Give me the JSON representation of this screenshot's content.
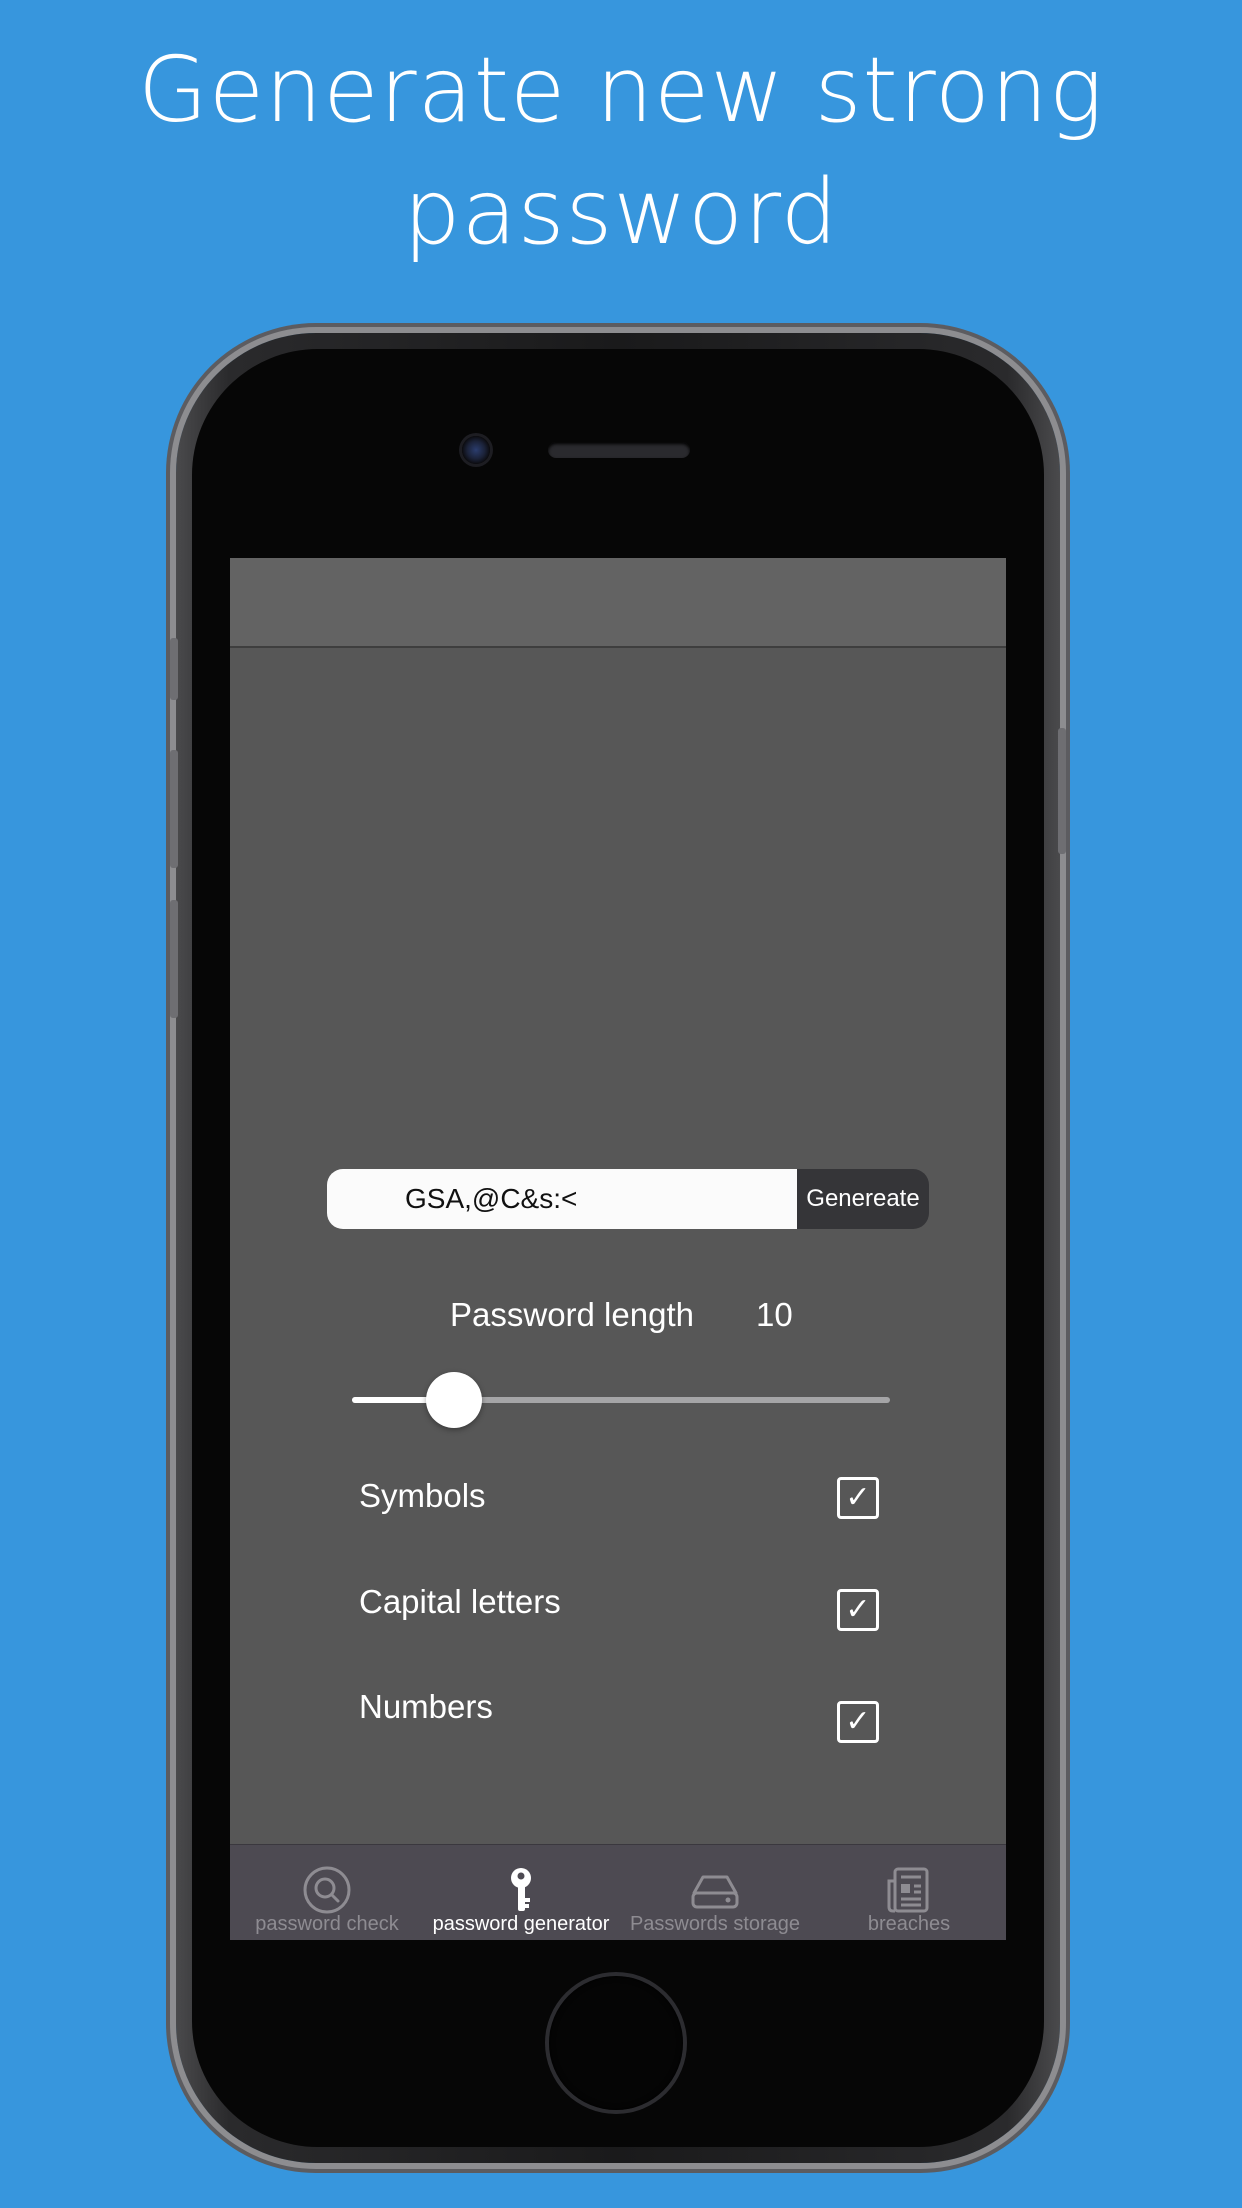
{
  "headline": {
    "line1": "Generate new strong",
    "line2": "password"
  },
  "generator": {
    "password_value": "GSA,@C&s:<",
    "generate_label": "Genereate",
    "length_label": "Password length",
    "length_value": "10",
    "slider_fraction": 0.19
  },
  "options": [
    {
      "label": "Symbols",
      "checked": true
    },
    {
      "label": "Capital letters",
      "checked": true
    },
    {
      "label": "Numbers",
      "checked": true
    }
  ],
  "tabbar": {
    "items": [
      {
        "label": "password check",
        "icon": "magnifier-icon",
        "active": false
      },
      {
        "label": "password generator",
        "icon": "key-icon",
        "active": true
      },
      {
        "label": "Passwords storage",
        "icon": "hard-drive-icon",
        "active": false
      },
      {
        "label": "breaches",
        "icon": "newspaper-icon",
        "active": false
      }
    ]
  },
  "colors": {
    "background": "#3796dd",
    "screen": "#575757",
    "navbar": "#636363",
    "tabbar": "#4d4a52",
    "generate_button": "#353538"
  }
}
